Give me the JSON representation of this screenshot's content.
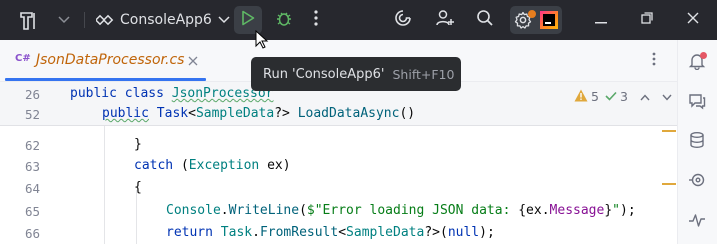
{
  "titlebar": {
    "run_config": "ConsoleApp6",
    "run_tooltip": "Run 'ConsoleApp6'",
    "run_shortcut": "Shift+F10",
    "icons": [
      "app-logo-icon",
      "chevron-down-icon",
      "run-icon",
      "debug-icon",
      "more-icon",
      "ai-assistant-icon",
      "add-user-icon",
      "search-icon",
      "settings-icon",
      "minimize-icon",
      "restore-icon",
      "close-icon"
    ]
  },
  "editor_tab": {
    "lang": "C#",
    "filename": "JsonDataProcessor.cs"
  },
  "inspections": {
    "warnings": "5",
    "checks": "3"
  },
  "colors": {
    "titlebar_bg": "#27282e",
    "run_green": "#5fb865",
    "accent_blue": "#3574f0",
    "keyword": "#0033b3",
    "warning": "#e0a83c"
  },
  "code": {
    "sticky": [
      {
        "num": "26",
        "parts": [
          [
            "kw",
            "public class "
          ],
          [
            "cls sq",
            "JsonProcessor"
          ]
        ]
      },
      {
        "num": "52",
        "parts": [
          [
            "kw sq",
            "public"
          ],
          [
            "",
            " "
          ],
          [
            "kw",
            "Task"
          ],
          [
            "",
            "<"
          ],
          [
            "cls",
            "SampleData"
          ],
          [
            "",
            "?> "
          ],
          [
            "fn",
            "LoadDataAsync"
          ],
          [
            "",
            "()"
          ]
        ]
      }
    ],
    "lines": [
      {
        "num": "62",
        "parts": [
          [
            "",
            "}"
          ]
        ]
      },
      {
        "num": "63",
        "parts": [
          [
            "kw",
            "catch"
          ],
          [
            "",
            " ("
          ],
          [
            "cls",
            "Exception"
          ],
          [
            "",
            " ex)"
          ]
        ]
      },
      {
        "num": "64",
        "parts": [
          [
            "",
            "{"
          ]
        ]
      },
      {
        "num": "65",
        "parts": [
          [
            "cls",
            "Console"
          ],
          [
            "",
            "."
          ],
          [
            "fn",
            "WriteLine"
          ],
          [
            "",
            "("
          ],
          [
            "str",
            "$\"Error loading JSON data: "
          ],
          [
            "",
            "{ex."
          ],
          [
            "prop",
            "Message"
          ],
          [
            "",
            "}"
          ],
          [
            "str",
            "\""
          ],
          [
            "",
            ");"
          ]
        ]
      },
      {
        "num": "66",
        "parts": [
          [
            "kw",
            "return"
          ],
          [
            "",
            " "
          ],
          [
            "cls",
            "Task"
          ],
          [
            "",
            "."
          ],
          [
            "fn",
            "FromResult"
          ],
          [
            "",
            "<"
          ],
          [
            "cls",
            "SampleData"
          ],
          [
            "",
            "?>("
          ],
          [
            "kw",
            "null"
          ],
          [
            "",
            ");"
          ]
        ]
      }
    ]
  }
}
